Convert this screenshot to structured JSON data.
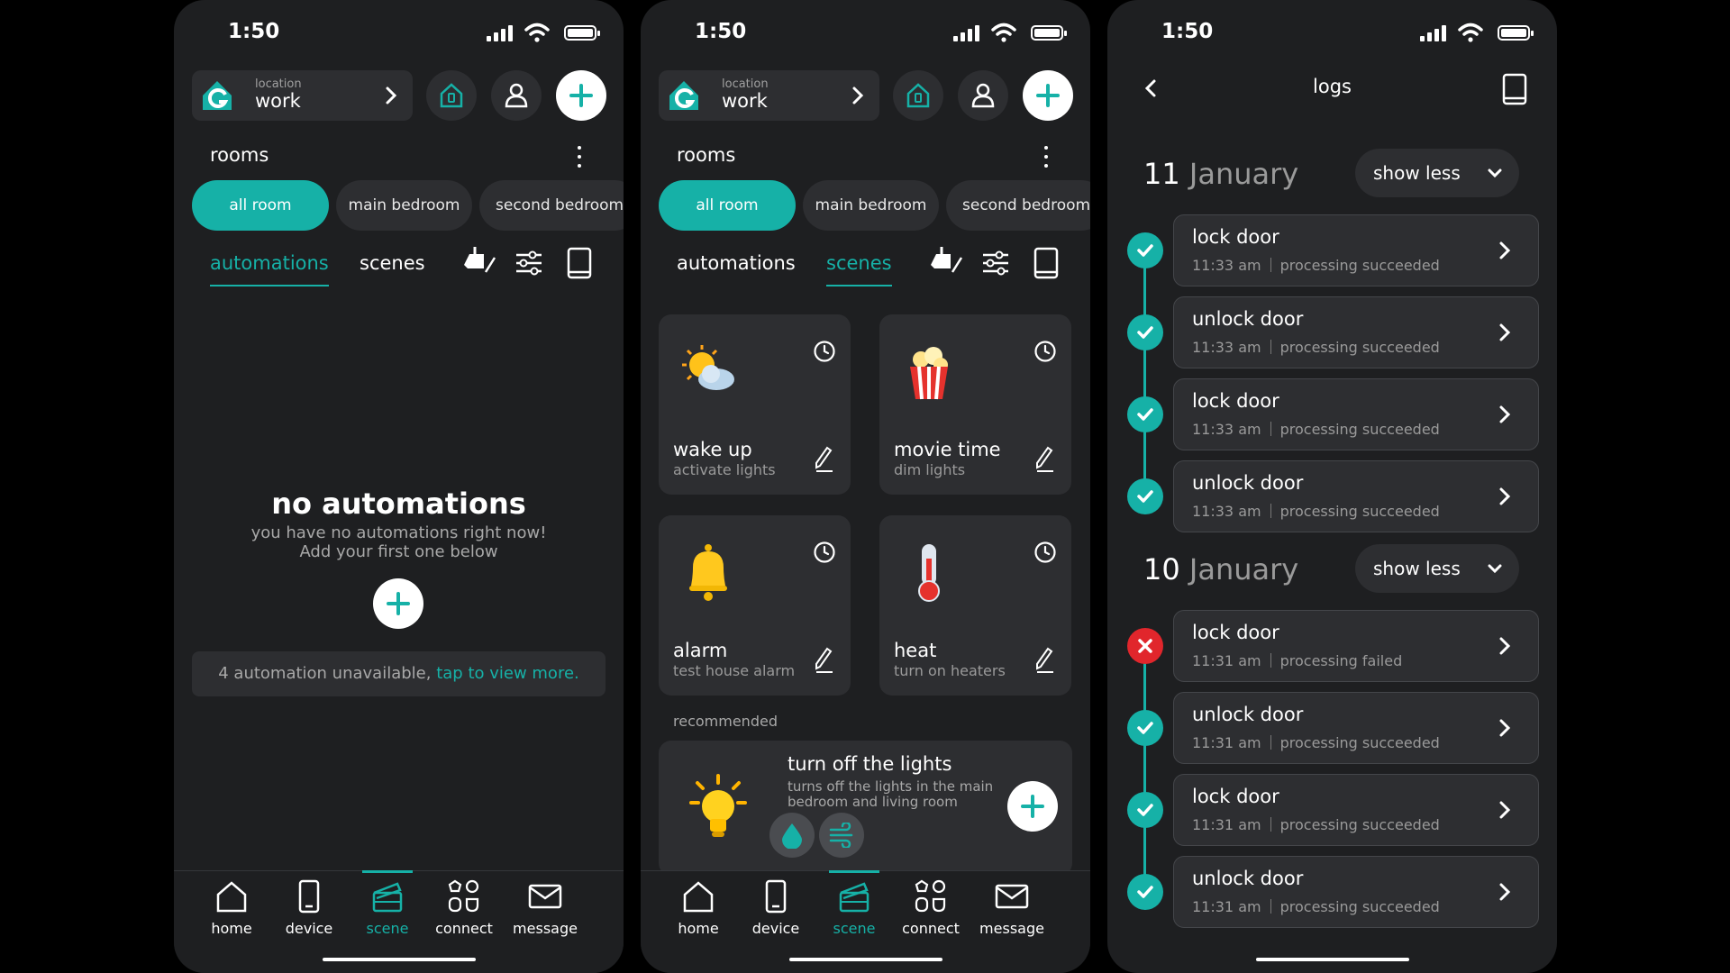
{
  "status": {
    "time": "1:50"
  },
  "header": {
    "location_label": "location",
    "location_value": "work"
  },
  "rooms": {
    "title": "rooms",
    "chips": [
      "all room",
      "main bedroom",
      "second bedroom"
    ]
  },
  "tabs": {
    "automations": "automations",
    "scenes": "scenes"
  },
  "screen1": {
    "empty_title": "no automations",
    "empty_line1": "you have no automations right now!",
    "empty_line2": "Add your first one below",
    "notice_text": "4 automation unavailable,",
    "notice_link": "tap to view more."
  },
  "screen2": {
    "scenes": [
      {
        "title": "wake up",
        "subtitle": "activate lights",
        "icon": "sun-cloud-icon"
      },
      {
        "title": "movie time",
        "subtitle": "dim lights",
        "icon": "popcorn-icon"
      },
      {
        "title": "alarm",
        "subtitle": "test house alarm",
        "icon": "bell-icon"
      },
      {
        "title": "heat",
        "subtitle": "turn on heaters",
        "icon": "thermometer-icon"
      }
    ],
    "recommended_label": "recommended",
    "recommended": {
      "title": "turn off the lights",
      "subtitle": "turns off the lights in the main bedroom and living room"
    }
  },
  "nav": {
    "home": "home",
    "device": "device",
    "scene": "scene",
    "connect": "connect",
    "message": "message",
    "active": "scene"
  },
  "logs": {
    "title": "logs",
    "groups": [
      {
        "day": "11",
        "month": "January",
        "toggle": "show less",
        "entries": [
          {
            "action": "lock door",
            "time": "11:33 am",
            "status": "processing succeeded",
            "ok": true
          },
          {
            "action": "unlock door",
            "time": "11:33 am",
            "status": "processing succeeded",
            "ok": true
          },
          {
            "action": "lock door",
            "time": "11:33 am",
            "status": "processing succeeded",
            "ok": true
          },
          {
            "action": "unlock door",
            "time": "11:33 am",
            "status": "processing succeeded",
            "ok": true
          }
        ]
      },
      {
        "day": "10",
        "month": "January",
        "toggle": "show less",
        "entries": [
          {
            "action": "lock door",
            "time": "11:31 am",
            "status": "processing failed",
            "ok": false
          },
          {
            "action": "unlock door",
            "time": "11:31 am",
            "status": "processing succeeded",
            "ok": true
          },
          {
            "action": "lock door",
            "time": "11:31 am",
            "status": "processing succeeded",
            "ok": true
          },
          {
            "action": "unlock door",
            "time": "11:31 am",
            "status": "processing succeeded",
            "ok": true
          }
        ]
      }
    ]
  },
  "colors": {
    "accent": "#16b1a7",
    "background": "#1e1f21",
    "card": "#2d2e31",
    "error": "#e1262c"
  }
}
